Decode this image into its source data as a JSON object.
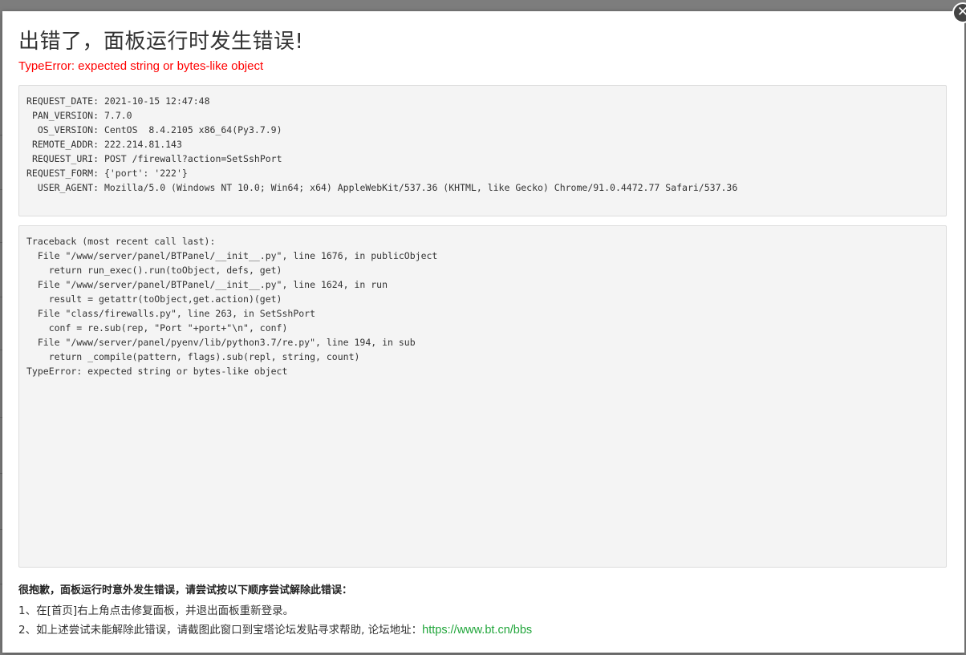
{
  "dialog": {
    "title": "出错了，面板运行时发生错误!",
    "error_message": "TypeError: expected string or bytes-like object",
    "close_symbol": "✕"
  },
  "request_info": [
    {
      "key": "REQUEST_DATE",
      "value": "2021-10-15 12:47:48"
    },
    {
      "key": "PAN_VERSION",
      "value": "7.7.0"
    },
    {
      "key": "OS_VERSION",
      "value": "CentOS  8.4.2105 x86_64(Py3.7.9)"
    },
    {
      "key": "REMOTE_ADDR",
      "value": "222.214.81.143"
    },
    {
      "key": "REQUEST_URI",
      "value": "POST /firewall?action=SetSshPort"
    },
    {
      "key": "REQUEST_FORM",
      "value": "{'port': '222'}"
    },
    {
      "key": "USER_AGENT",
      "value": "Mozilla/5.0 (Windows NT 10.0; Win64; x64) AppleWebKit/537.36 (KHTML, like Gecko) Chrome/91.0.4472.77 Safari/537.36"
    }
  ],
  "traceback": [
    "Traceback (most recent call last):",
    "  File \"/www/server/panel/BTPanel/__init__.py\", line 1676, in publicObject",
    "    return run_exec().run(toObject, defs, get)",
    "  File \"/www/server/panel/BTPanel/__init__.py\", line 1624, in run",
    "    result = getattr(toObject,get.action)(get)",
    "  File \"class/firewalls.py\", line 263, in SetSshPort",
    "    conf = re.sub(rep, \"Port \"+port+\"\\n\", conf)",
    "  File \"/www/server/panel/pyenv/lib/python3.7/re.py\", line 194, in sub",
    "    return _compile(pattern, flags).sub(repl, string, count)",
    "TypeError: expected string or bytes-like object"
  ],
  "help": {
    "heading": "很抱歉，面板运行时意外发生错误，请尝试按以下顺序尝试解除此错误：",
    "step1": "1、在[首页]右上角点击修复面板，并退出面板重新登录。",
    "step2_prefix": "2、如上述尝试未能解除此错误，请截图此窗口到宝塔论坛发贴寻求帮助, 论坛地址：",
    "forum_url": "https://www.bt.cn/bbs"
  },
  "colors": {
    "error": "#ff0000",
    "link": "#20a53a",
    "overlay": "#7d7d7d"
  }
}
